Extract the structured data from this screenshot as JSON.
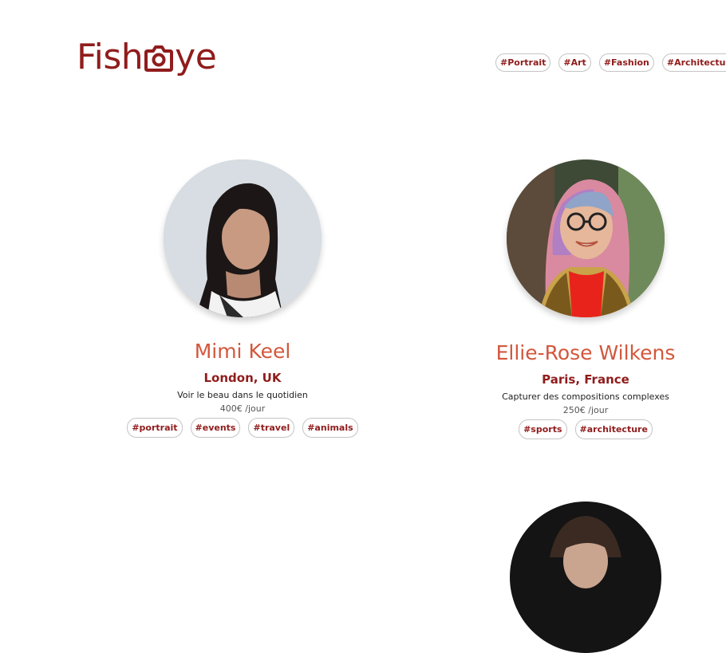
{
  "header": {
    "logo_text_left": "Fish",
    "logo_text_right": "ye",
    "nav_tags": [
      "#Portrait",
      "#Art",
      "#Fashion",
      "#Architecture"
    ]
  },
  "photographers": [
    {
      "name": "Mimi Keel",
      "location": "London, UK",
      "tagline": "Voir le beau dans le quotidien",
      "price": "400€ /jour",
      "tags": [
        "#portrait",
        "#events",
        "#travel",
        "#animals"
      ]
    },
    {
      "name": "Ellie-Rose Wilkens",
      "location": "Paris, France",
      "tagline": "Capturer des compositions complexes",
      "price": "250€ /jour",
      "tags": [
        "#sports",
        "#architecture"
      ]
    }
  ],
  "colors": {
    "brand": "#901c1c",
    "name": "#d3573c"
  }
}
